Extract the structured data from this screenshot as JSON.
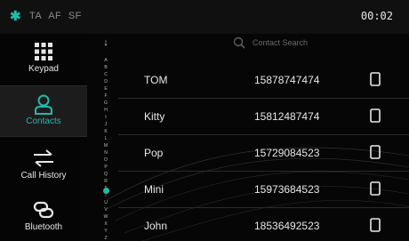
{
  "status": {
    "bluetooth_glyph": "✱",
    "flags": [
      "TA",
      "AF",
      "SF"
    ],
    "time": "00:02"
  },
  "sidebar": {
    "items": [
      {
        "label": "Keypad",
        "icon": "keypad-icon"
      },
      {
        "label": "Contacts",
        "icon": "contacts-icon",
        "active": true
      },
      {
        "label": "Call History",
        "icon": "call-history-icon"
      },
      {
        "label": "Bluetooth",
        "icon": "bluetooth-link-icon"
      }
    ]
  },
  "alphabet": {
    "top_arrow": "↓",
    "letters": [
      "A",
      "B",
      "C",
      "D",
      "E",
      "F",
      "G",
      "H",
      "I",
      "J",
      "K",
      "L",
      "M",
      "N",
      "O",
      "P",
      "Q",
      "R",
      "S",
      "T",
      "U",
      "V",
      "W",
      "X",
      "Y",
      "Z"
    ]
  },
  "search": {
    "placeholder": "Contact Search"
  },
  "contacts": [
    {
      "name": "TOM",
      "number": "15878747474"
    },
    {
      "name": "Kitty",
      "number": "15812487474"
    },
    {
      "name": "Pop",
      "number": "15729084523"
    },
    {
      "name": "Mini",
      "number": "15973684523"
    },
    {
      "name": "John",
      "number": "18536492523"
    }
  ],
  "colors": {
    "accent": "#22b9a8",
    "text": "#e8e8e8",
    "background": "#060606"
  }
}
